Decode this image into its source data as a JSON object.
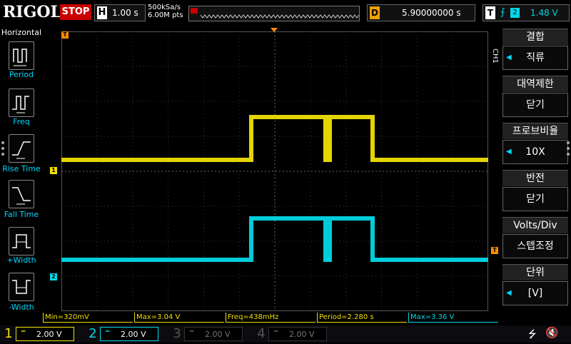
{
  "topbar": {
    "brand": "RIGOL",
    "run_state": "STOP",
    "timebase_label": "H",
    "timebase_value": "1.00 s",
    "sample_rate": "500kSa/s",
    "memory_depth": "6.00M pts",
    "delay_label": "D",
    "delay_value": "5.90000000 s",
    "trigger_label": "T",
    "trigger_edge_icon": "rising-edge-icon",
    "trigger_source": "2",
    "trigger_level": "1.48 V"
  },
  "left_menu": {
    "title": "Horizontal",
    "items": [
      {
        "label": "Period",
        "icon": "period-icon"
      },
      {
        "label": "Freq",
        "icon": "frequency-icon"
      },
      {
        "label": "Rise Time",
        "icon": "rise-time-icon"
      },
      {
        "label": "Fall Time",
        "icon": "fall-time-icon"
      },
      {
        "label": "+Width",
        "icon": "positive-width-icon"
      },
      {
        "label": "-Width",
        "icon": "negative-width-icon"
      }
    ]
  },
  "right_menu": {
    "channel_tag": "CH1",
    "items": [
      {
        "label": "결합",
        "value": "직류",
        "arrow": true
      },
      {
        "label": "대역제한",
        "value": "닫기",
        "arrow": false
      },
      {
        "label": "프로브비율",
        "value": "10X",
        "arrow": true
      },
      {
        "label": "반전",
        "value": "닫기",
        "arrow": false
      },
      {
        "label": "Volts/Div",
        "value": "스텝조정",
        "arrow": false
      },
      {
        "label": "단위",
        "value": "[V]",
        "arrow": true
      }
    ]
  },
  "markers": {
    "trigger_pos": "T",
    "ch1": "1",
    "ch2": "2",
    "trig_level": "T"
  },
  "measurements": [
    {
      "text": "Min=320mV",
      "color": "#f0e000"
    },
    {
      "text": "Max=3.04 V",
      "color": "#f0e000"
    },
    {
      "text": "Freq=438mHz",
      "color": "#f0e000"
    },
    {
      "text": "Period=2.280 s",
      "color": "#f0e000"
    },
    {
      "text": "Max=3.36 V",
      "color": "#00d8e8"
    }
  ],
  "channels": [
    {
      "num": "1",
      "scale": "2.00 V",
      "color": "#f0e000",
      "active": true
    },
    {
      "num": "2",
      "scale": "2.00 V",
      "color": "#00d8e8",
      "active": true
    },
    {
      "num": "3",
      "scale": "2.00 V",
      "color": "#555555",
      "active": false
    },
    {
      "num": "4",
      "scale": "2.00 V",
      "color": "#555555",
      "active": false
    }
  ],
  "status_icons": [
    "usb-icon",
    "speaker-muted-icon"
  ],
  "colors": {
    "ch1": "#f0e000",
    "ch2": "#00d8e8",
    "stop": "#c80000",
    "delay_accent": "#f0a000",
    "trigger_marker": "#ff8c00"
  }
}
